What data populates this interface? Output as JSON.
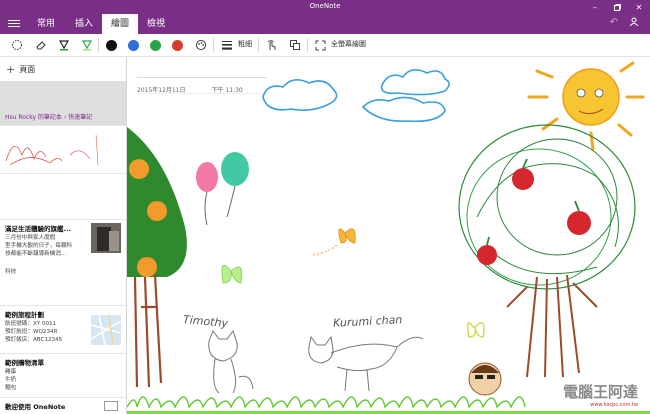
{
  "window": {
    "title": "OneNote"
  },
  "ribbon": {
    "tabs": [
      {
        "label": "常用"
      },
      {
        "label": "插入"
      },
      {
        "label": "繪圖",
        "active": true
      },
      {
        "label": "檢視"
      }
    ]
  },
  "toolbar": {
    "pen_colors": [
      "#111111",
      "#2f6fd6",
      "#2ca349",
      "#d83b2b"
    ],
    "line_label": "粗細",
    "fullscreen_label": "全螢幕繪圖"
  },
  "sidebar": {
    "add_page_label": "頁面",
    "selected_page": {
      "breadcrumb": "Hsu Rocky 的筆記本 › 快速筆記"
    },
    "pages": [
      {
        "title": "滿足生活體驗的旗艦...",
        "lines": [
          "三月份中與家人度假",
          "型手機大觀的日子，每顆科",
          "技都能不斷報導新機消..."
        ],
        "tag": "科技"
      },
      {
        "title": "範例旅程計劃",
        "lines": [
          "航班號碼：XY 0011",
          "預訂航班：WQ234R",
          "預訂飯店：ABC12345"
        ]
      },
      {
        "title": "範例購物清單",
        "lines": [
          "雞蛋",
          "牛奶",
          "麵包"
        ]
      },
      {
        "title": "歡迎使用 OneNote"
      }
    ]
  },
  "canvas": {
    "date": "2015年12月11日",
    "time": "下午 11:30",
    "handwriting": [
      "Timothy",
      "Kurumi chan"
    ]
  },
  "watermark": {
    "text": "電腦王阿達",
    "url": "www.kocpc.com.tw"
  }
}
